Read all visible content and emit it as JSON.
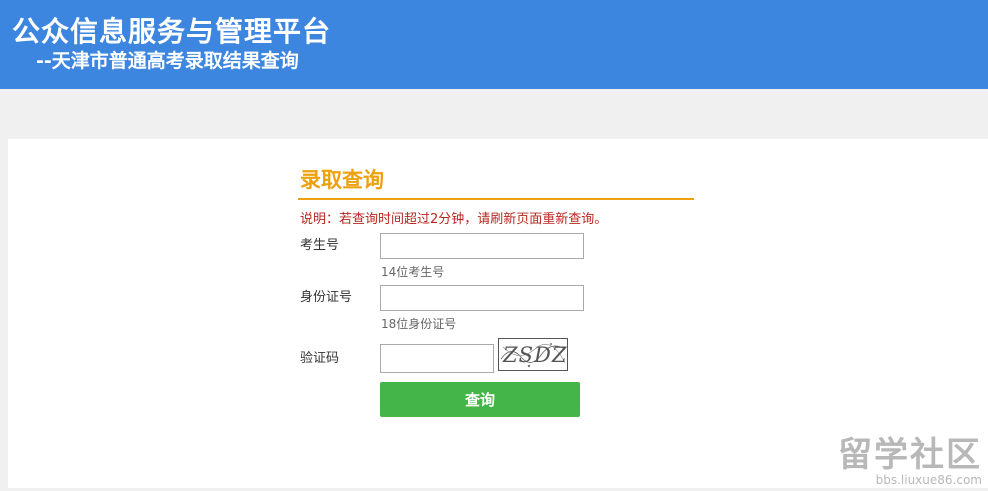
{
  "header": {
    "title": "公众信息服务与管理平台",
    "subtitle": "--天津市普通高考录取结果查询",
    "background": "#3d86e0"
  },
  "form": {
    "title": "录取查询",
    "notice": "说明：若查询时间超过2分钟，请刷新页面重新查询。",
    "fields": [
      {
        "label": "考生号",
        "hint": "14位考生号",
        "value": ""
      },
      {
        "label": "身份证号",
        "hint": "18位身份证号",
        "value": ""
      },
      {
        "label": "验证码",
        "value": ""
      }
    ],
    "captcha": "ZSDZ",
    "submit_label": "查询",
    "accent_color": "#eda10f",
    "button_color": "#44b549"
  },
  "watermark": {
    "text": "留学社区",
    "url": "bbs.liuxue86.com"
  }
}
